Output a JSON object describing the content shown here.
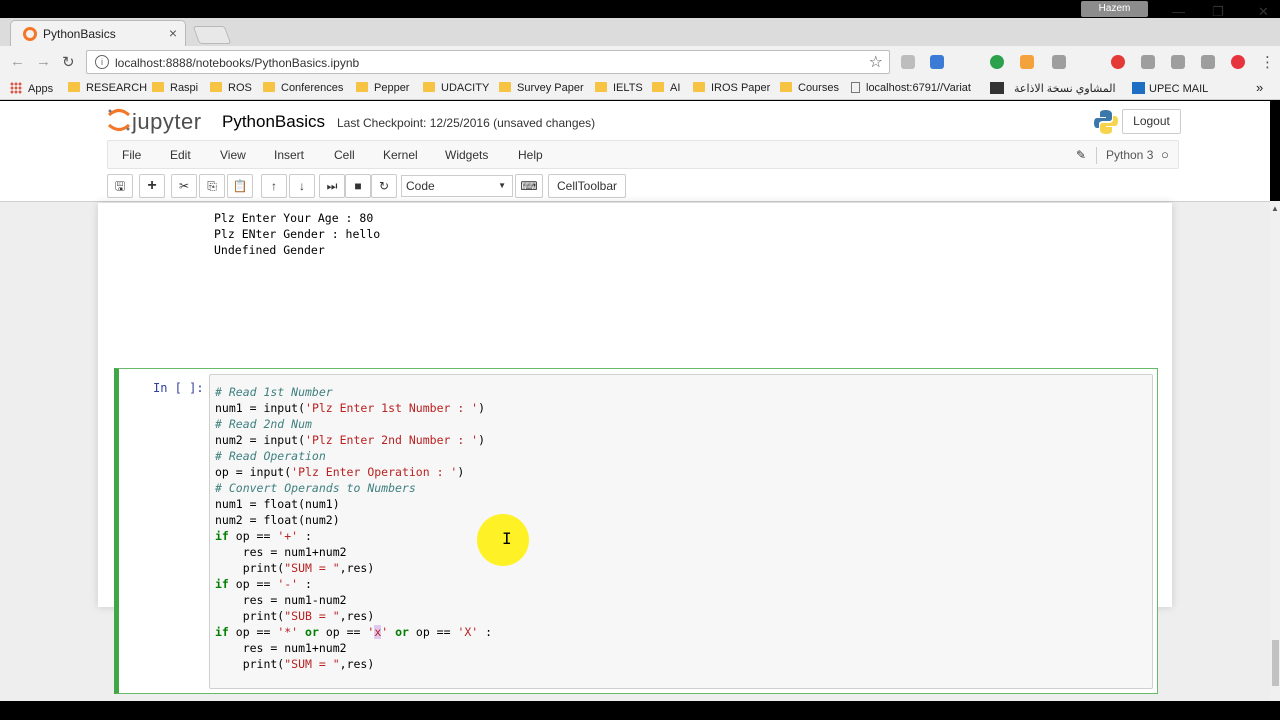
{
  "browser": {
    "tab_title": "PythonBasics",
    "tab_close": "×",
    "profile_name": "Hazem",
    "url": "localhost:8888/notebooks/PythonBasics.ipynb",
    "window_controls": {
      "minimize": "—",
      "restore": "❐",
      "close": "✕"
    },
    "nav": {
      "back": "←",
      "forward": "→",
      "reload": "↻"
    },
    "info_icon": "i",
    "star_icon": "☆",
    "more_icon": "⋮",
    "bookmarks_overflow": "»",
    "bookmarks": [
      "Apps",
      "RESEARCH",
      "Raspi",
      "ROS",
      "Conferences",
      "Pepper",
      "UDACITY",
      "Survey Paper",
      "IELTS",
      "AI",
      "IROS Paper",
      "Courses",
      "localhost:6791//Variat",
      "المشاوي نسخة الاذاعة",
      "UPEC MAIL"
    ],
    "extension_colors": [
      "#bdbdbd",
      "#3b7bd6",
      "#2ba14b",
      "#f4a23b",
      "#9e9e9e",
      "#e53935",
      "#9e9e9e",
      "#9e9e9e",
      "#9e9e9e",
      "#e6343f"
    ]
  },
  "jupyter": {
    "logo_text": "jupyter",
    "notebook_name": "PythonBasics",
    "checkpoint": "Last Checkpoint: 12/25/2016 (unsaved changes)",
    "logout_label": "Logout",
    "menu": [
      "File",
      "Edit",
      "View",
      "Insert",
      "Cell",
      "Kernel",
      "Widgets",
      "Help"
    ],
    "kernel_name": "Python 3",
    "cell_type": "Code",
    "celltoolbar_label": "CellToolbar",
    "toolbar_icons": {
      "save": "🖫",
      "add": "+",
      "cut": "✂",
      "copy": "⎘",
      "paste": "📋",
      "up": "↑",
      "down": "↓",
      "run": "⏭",
      "stop": "■",
      "restart": "↻",
      "keyboard": "⌨",
      "pencil": "✎",
      "kernel_idle": "○",
      "select_caret": "▼"
    }
  },
  "output_lines": [
    "Plz Enter Your Age : 80",
    "Plz ENter Gender : hello",
    "Undefined Gender"
  ],
  "cell": {
    "prompt": "In [ ]:",
    "code_lines": [
      "# Read 1st Number",
      "num1 = input('Plz Enter 1st Number : ')",
      "# Read 2nd Num",
      "num2 = input('Plz Enter 2nd Number : ')",
      "# Read Operation",
      "op = input('Plz Enter Operation : ')",
      "# Convert Operands to Numbers",
      "num1 = float(num1)",
      "num2 = float(num2)",
      "if op == '+' :",
      "    res = num1+num2",
      "    print(\"SUM = \",res)",
      "if op == '-' :",
      "    res = num1-num2",
      "    print(\"SUB = \",res)",
      "if op == '*' or op == 'x' or op == 'X' :",
      "    res = num1+num2",
      "    print(\"SUM = \",res)"
    ]
  },
  "cursor": {
    "ibeam": "I"
  },
  "scrollbar": {
    "up_arrow": "▲"
  }
}
